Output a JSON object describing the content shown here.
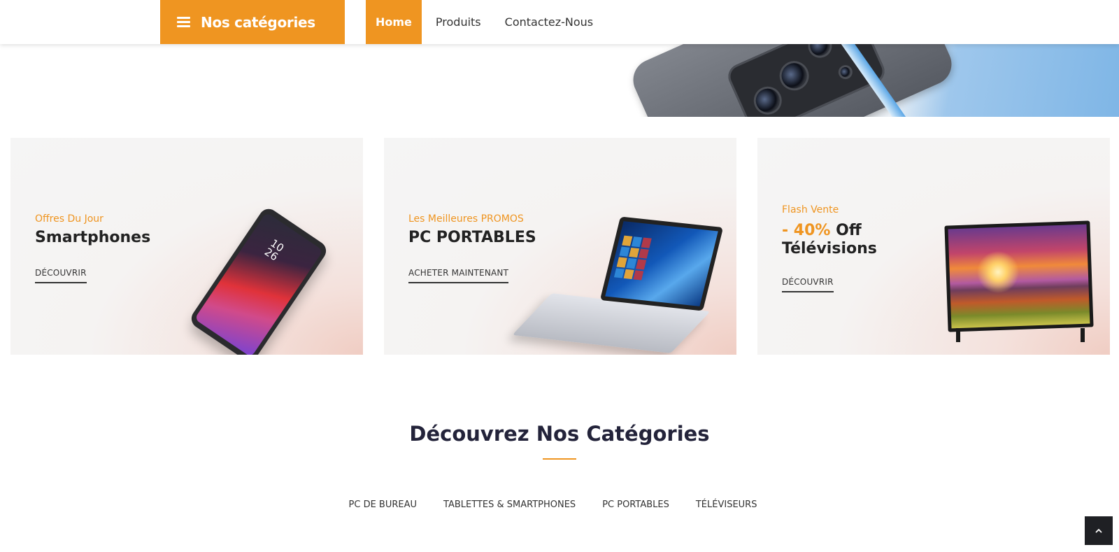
{
  "header": {
    "categories_label": "Nos catégories",
    "nav": [
      {
        "label": "Home",
        "active": true
      },
      {
        "label": "Produits",
        "active": false
      },
      {
        "label": "Contactez-Nous",
        "active": false
      }
    ]
  },
  "promos": [
    {
      "tag": "Offres Du Jour",
      "title": "Smartphones",
      "cta": "DÉCOUVRIR",
      "image": "smartphone-image"
    },
    {
      "tag": "Les Meilleures PROMOS",
      "title": "PC PORTABLES",
      "cta": "ACHETER MAINTENANT",
      "image": "laptop-image"
    },
    {
      "tag": "Flash Vente",
      "highlight": "- 40%",
      "title_rest": "Off",
      "title_line2": "Télévisions",
      "cta": "DÉCOUVRIR",
      "image": "tv-image"
    }
  ],
  "phone_clock": {
    "hour": "10",
    "minute": "26"
  },
  "categories": {
    "title": "Découvrez Nos Catégories",
    "tabs": [
      "PC DE BUREAU",
      "TABLETTES & SMARTPHONES",
      "PC PORTABLES",
      "TÉLÉVISEURS"
    ]
  },
  "colors": {
    "accent": "#ef9521",
    "dark": "#23233a"
  },
  "icons": {
    "menu": "hamburger-icon",
    "scroll_top": "chevron-up-icon"
  }
}
